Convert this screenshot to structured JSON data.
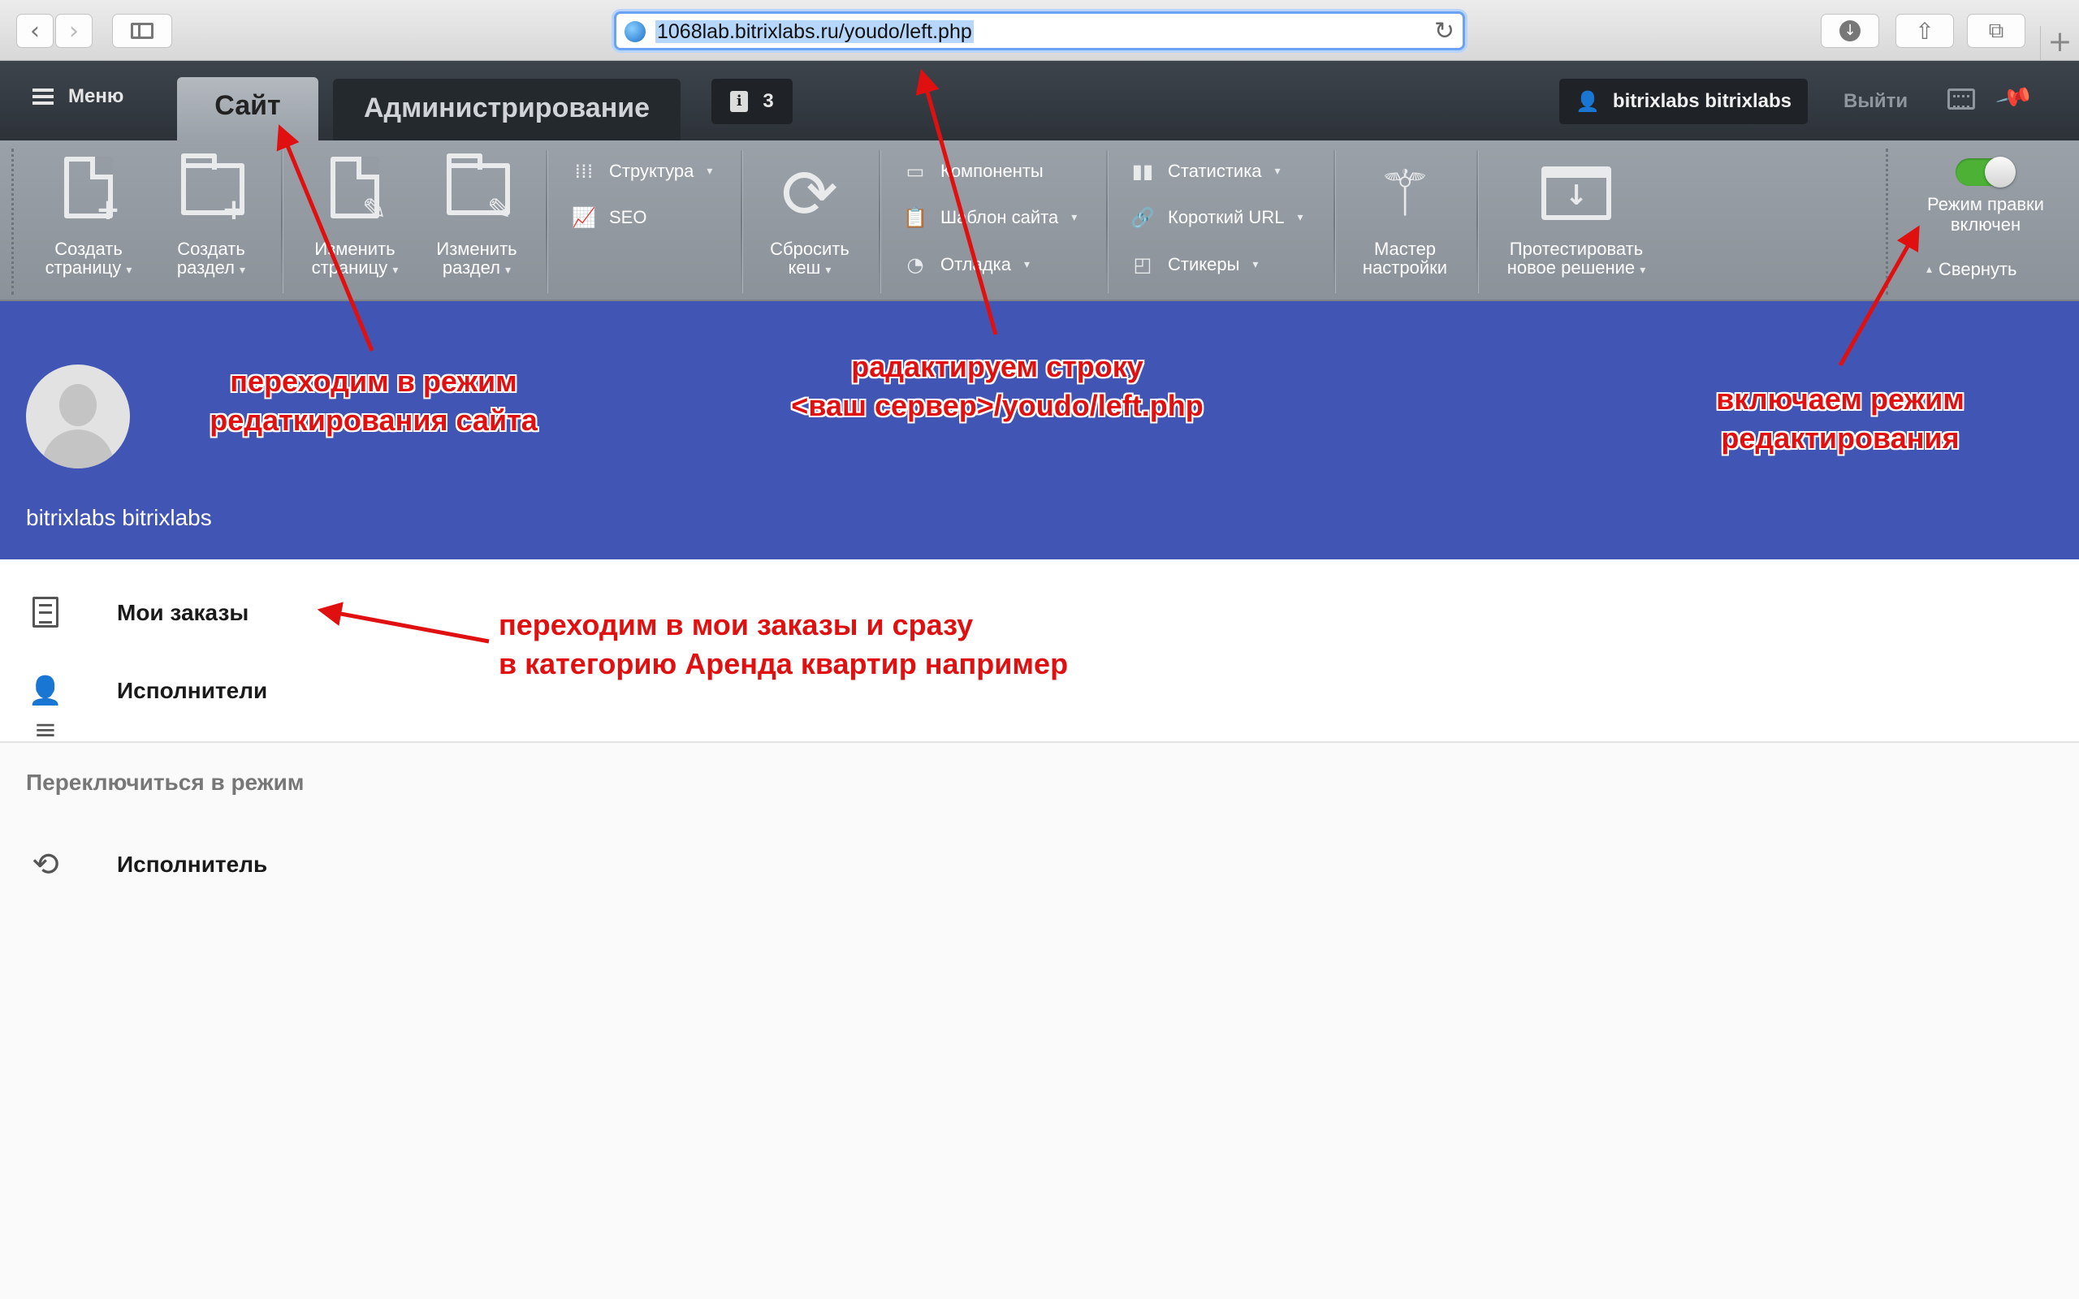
{
  "browser": {
    "url": "1068lab.bitrixlabs.ru/youdo/left.php",
    "back_icon": "chevron-left-icon",
    "forward_icon": "chevron-right-icon",
    "sidebar_icon": "sidebar-icon",
    "download_icon": "download-icon",
    "share_icon": "share-icon",
    "tabs_icon": "tabs-icon",
    "new_tab_icon": "plus-icon"
  },
  "admin_panel": {
    "menu_label": "Меню",
    "tab_site": "Сайт",
    "tab_admin": "Администрирование",
    "notifications_count": "3",
    "user_name": "bitrixlabs bitrixlabs",
    "logout_label": "Выйти"
  },
  "toolbar": {
    "create_page": [
      "Создать",
      "страницу"
    ],
    "create_section": [
      "Создать",
      "раздел"
    ],
    "edit_page": [
      "Изменить",
      "страницу"
    ],
    "edit_section": [
      "Изменить",
      "раздел"
    ],
    "structure": "Структура",
    "seo": "SEO",
    "reset_cache": [
      "Сбросить",
      "кеш"
    ],
    "components": "Компоненты",
    "site_template": "Шаблон сайта",
    "debug": "Отладка",
    "statistics": "Статистика",
    "short_url": "Короткий URL",
    "stickers": "Стикеры",
    "setup_wizard": [
      "Мастер",
      "настройки"
    ],
    "test_solution": [
      "Протестировать",
      "новое решение"
    ],
    "edit_mode": [
      "Режим правки",
      "включен"
    ],
    "edit_mode_on": true,
    "collapse": "Свернуть"
  },
  "profile": {
    "name": "bitrixlabs bitrixlabs"
  },
  "menu": {
    "items": [
      {
        "label": "Мои заказы",
        "icon": "list-icon"
      },
      {
        "label": "Исполнители",
        "icon": "users-list-icon"
      }
    ],
    "switch_title": "Переключиться в режим",
    "switch_item": {
      "label": "Исполнитель",
      "icon": "refresh-icon"
    }
  },
  "annotations": {
    "site_mode": [
      "переходим в режим",
      "редаткирования сайта"
    ],
    "edit_url": [
      "радактируем строку",
      "<ваш сервер>/youdo/left.php"
    ],
    "enable_edit": [
      "включаем режим",
      "редактирования"
    ],
    "orders": [
      "переходим в мои заказы и сразу",
      "в категорию Аренда квартир например"
    ]
  },
  "colors": {
    "profile_bg": "#4155b5",
    "annotation": "#e01010",
    "toggle_on": "#4cb135"
  }
}
